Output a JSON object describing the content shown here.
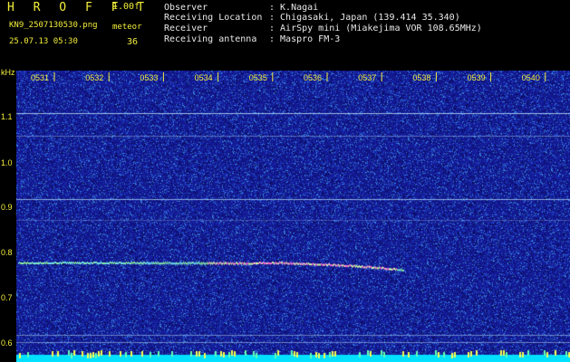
{
  "header": {
    "app_title": "H R O F F T",
    "version": "1.00f",
    "filename": "KN9_2507130530.png",
    "datetime": "25.07.13 05:30",
    "meteor_label": "meteor",
    "meteor_count": "36",
    "meta": [
      {
        "key": "Observer",
        "value": ": K.Nagai"
      },
      {
        "key": "Receiving Location",
        "value": ": Chigasaki, Japan (139.414 35.340)"
      },
      {
        "key": "Receiver",
        "value": ": AirSpy mini (Miakejima VOR 108.65MHz)"
      },
      {
        "key": "Receiving antenna",
        "value": ": Maspro FM-3"
      }
    ]
  },
  "spectrogram": {
    "y_unit": "kHz",
    "y_ticks": [
      "1.1",
      "1.0",
      "0.9",
      "0.8",
      "0.7",
      "0.6"
    ],
    "x_ticks": [
      "0531",
      "0532",
      "0533",
      "0534",
      "0535",
      "0536",
      "0537",
      "0538",
      "0539",
      "0540"
    ],
    "colors": {
      "noise_base": "#1a1fa8",
      "carrier_line": "#bfe8ff",
      "tick_color": "#f2ee3a",
      "bottom_band": "#00e0ff"
    }
  }
}
